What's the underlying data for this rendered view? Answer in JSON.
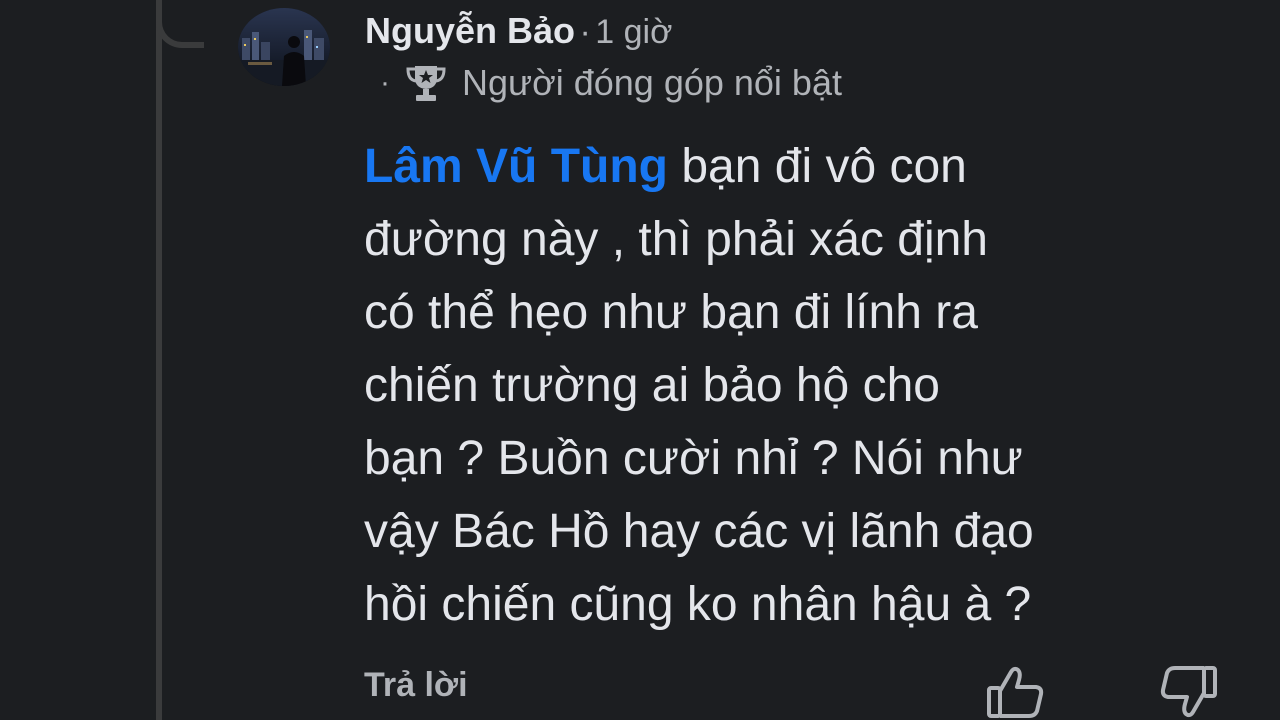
{
  "comment": {
    "author": "Nguyễn Bảo",
    "separator": "·",
    "time": "1 giờ",
    "badge": {
      "dot": "·",
      "icon": "trophy-icon",
      "label": "Người đóng góp nổi bật"
    },
    "mention": "Lâm Vũ Tùng",
    "lines": [
      " bạn đi vô con",
      "đường này , thì phải xác định",
      "có thể hẹo như bạn đi lính ra",
      "chiến trường ai bảo hộ cho",
      "bạn ? Buồn cười nhỉ ? Nói như",
      "vậy Bác Hồ hay các vị lãnh đạo",
      "hồi chiến cũng ko nhân hậu à ?"
    ],
    "actions": {
      "reply_label": "Trả lời",
      "upvote_icon": "thumbs-up-icon",
      "downvote_icon": "thumbs-down-icon"
    }
  },
  "colors": {
    "background": "#1c1e21",
    "text": "#e4e6eb",
    "secondary": "#b0b3b8",
    "mention": "#1877f2",
    "thread_line": "#3a3b3c"
  }
}
